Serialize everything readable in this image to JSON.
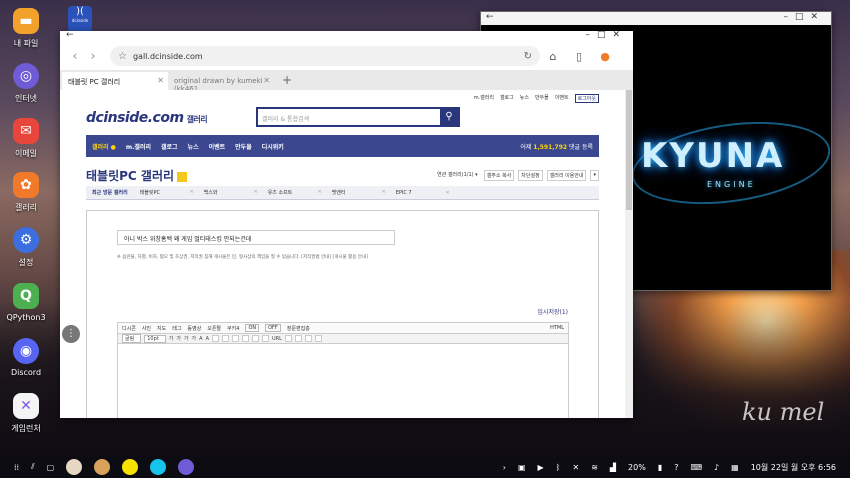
{
  "desktop": {
    "icons": [
      {
        "label": "내 파일",
        "color": "#f2a12b",
        "glyph": "▬"
      },
      {
        "label": "인터넷",
        "color": "#6f5bd6",
        "glyph": "◎"
      },
      {
        "label": "이메일",
        "color": "#e8463c",
        "glyph": "✉"
      },
      {
        "label": "갤러리",
        "color": "#f07a2a",
        "glyph": "✿"
      },
      {
        "label": "설정",
        "color": "#3b6fe0",
        "glyph": "⚙"
      },
      {
        "label": "QPython3",
        "color": "#4caf50",
        "glyph": "Q"
      },
      {
        "label": "Discord",
        "color": "#5865f2",
        "glyph": "◉"
      },
      {
        "label": "게임런처",
        "color": "#f4f4f4",
        "glyph": "✕"
      }
    ],
    "top_app_label": "dcinside",
    "top_app_glyph": ")(",
    "signature": "ku mel"
  },
  "browser": {
    "url": "gall.dcinside.com",
    "tabs": [
      {
        "label": "태블릿 PC 갤러리"
      },
      {
        "label": "original drawn by kumeki (kk461..."
      }
    ],
    "page": {
      "util_links": [
        "m.갤러리",
        "갤로그",
        "뉴스",
        "만두몰",
        "이벤트",
        "로그아웃"
      ],
      "logo": "dcinside.com",
      "logo_sub": "갤러리",
      "search_placeholder": "갤러리 & 통합검색",
      "gnb": [
        "갤러리 ●",
        "m.갤러리",
        "갤로그",
        "뉴스",
        "이벤트",
        "만두몰",
        "디시위키"
      ],
      "stats_prefix": "어제",
      "stats_value": "1,591,792",
      "stats_suffix": "댓글 등록",
      "gallery_title": "태블릿PC 갤러리",
      "gallery_tools": [
        "연관 갤러리(1/1) ▾",
        "갤주소 복사",
        "차단설정",
        "갤러리 이용안내",
        "▾"
      ],
      "recent_header": "최근 방문 갤러리",
      "recent_items": [
        "태블릿PC",
        "백스와",
        "유즈 소프트",
        "멧엔터",
        "EPIC 7"
      ],
      "subject": "아니 박스 위창홈백 왜 게임 멀티태스킹 안되는건데",
      "notice": "※ 음란물, 차별, 비하, 혐오 및 초상권, 저작권 침해 게시물은 민, 형사상의 책임을 질 수 있습니다. [저작권법 안내] [게시물 활용 안내]",
      "draft_label": "임시저장(1)",
      "editor_toolbar1": [
        "디시콘",
        "사진",
        "지도",
        "태그",
        "동영상",
        "오픈짤",
        "쿠키4",
        "ON",
        "OFF",
        "장문편집층",
        "HTML"
      ],
      "editor_toolbar2": {
        "font": "굴림",
        "size": "10pt",
        "format_buttons": [
          "가",
          "가",
          "가",
          "가",
          "A",
          "A"
        ],
        "misc": "URL"
      }
    }
  },
  "game_window": {
    "logo_word": "KYUNA",
    "logo_sub": "ENGINE"
  },
  "taskbar": {
    "battery": "20%",
    "date_time": "10월 22일 월 오후 6:56"
  }
}
